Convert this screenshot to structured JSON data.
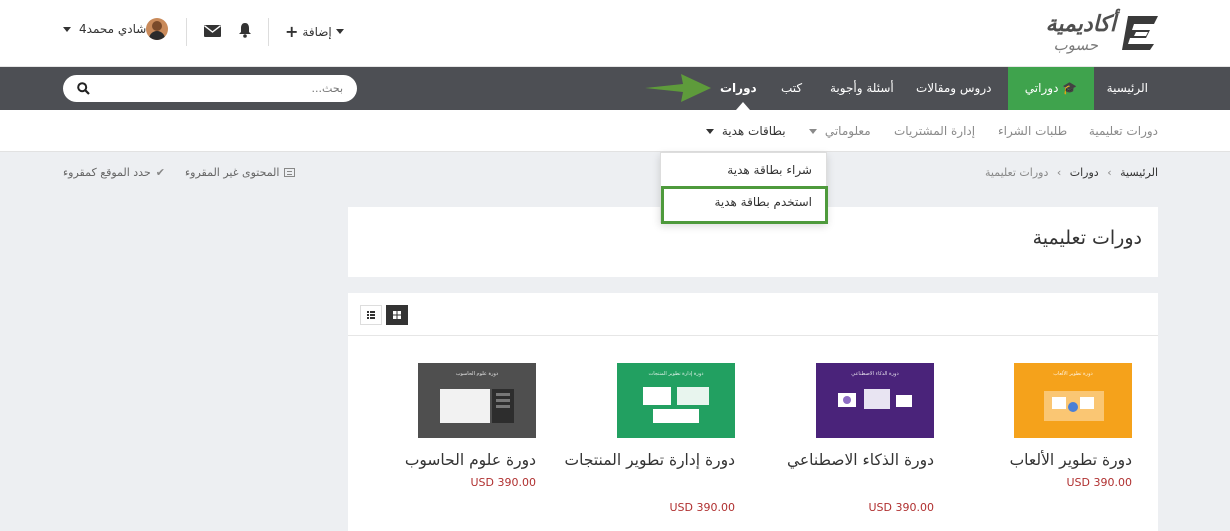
{
  "logo": {
    "main": "أكاديمية",
    "sub": "حسوب"
  },
  "user": {
    "name": "شادي محمد4",
    "add_label": "إضافة"
  },
  "nav": {
    "items": [
      {
        "label": "الرئيسية"
      },
      {
        "label": "دوراتي"
      },
      {
        "label": "دروس ومقالات"
      },
      {
        "label": "أسئلة وأجوبة"
      },
      {
        "label": "كتب"
      },
      {
        "label": "دورات"
      }
    ],
    "search_placeholder": "بحث..."
  },
  "subnav": {
    "items": [
      {
        "label": "دورات تعليمية"
      },
      {
        "label": "طلبات الشراء"
      },
      {
        "label": "إدارة المشتريات"
      },
      {
        "label": "معلوماتي"
      },
      {
        "label": "بطاقات هدية"
      }
    ]
  },
  "dropdown": {
    "items": [
      {
        "label": "شراء بطاقة هدية"
      },
      {
        "label": "استخدم بطاقة هدية"
      }
    ]
  },
  "breadcrumb": {
    "home": "الرئيسية",
    "section": "دورات",
    "current": "دورات تعليمية"
  },
  "read_tools": {
    "unread": "المحتوى غير المقروء",
    "mark_read": "حدد الموقع كمقروء"
  },
  "page": {
    "title": "دورات تعليمية"
  },
  "courses": [
    {
      "title": "دورة تطوير الألعاب",
      "price": "USD 390.00",
      "thumb_caption": "دورة تطوير الألعاب",
      "thumb_color": "#f5a21b"
    },
    {
      "title": "دورة الذكاء الاصطناعي",
      "price": "USD 390.00",
      "thumb_caption": "دورة الذكاء الاصطناعي",
      "thumb_color": "#4a237a"
    },
    {
      "title": "دورة إدارة تطوير المنتجات",
      "price": "USD 390.00",
      "thumb_caption": "دورة إدارة تطوير المنتجات",
      "thumb_color": "#22a061"
    },
    {
      "title": "دورة علوم الحاسوب",
      "price": "USD 390.00",
      "thumb_caption": "دورة علوم الحاسوب",
      "thumb_color": "#4f4f4f"
    }
  ],
  "colors": {
    "nav_bg": "#4d4f54",
    "active_green": "#3fa34d",
    "price_red": "#b03030"
  }
}
